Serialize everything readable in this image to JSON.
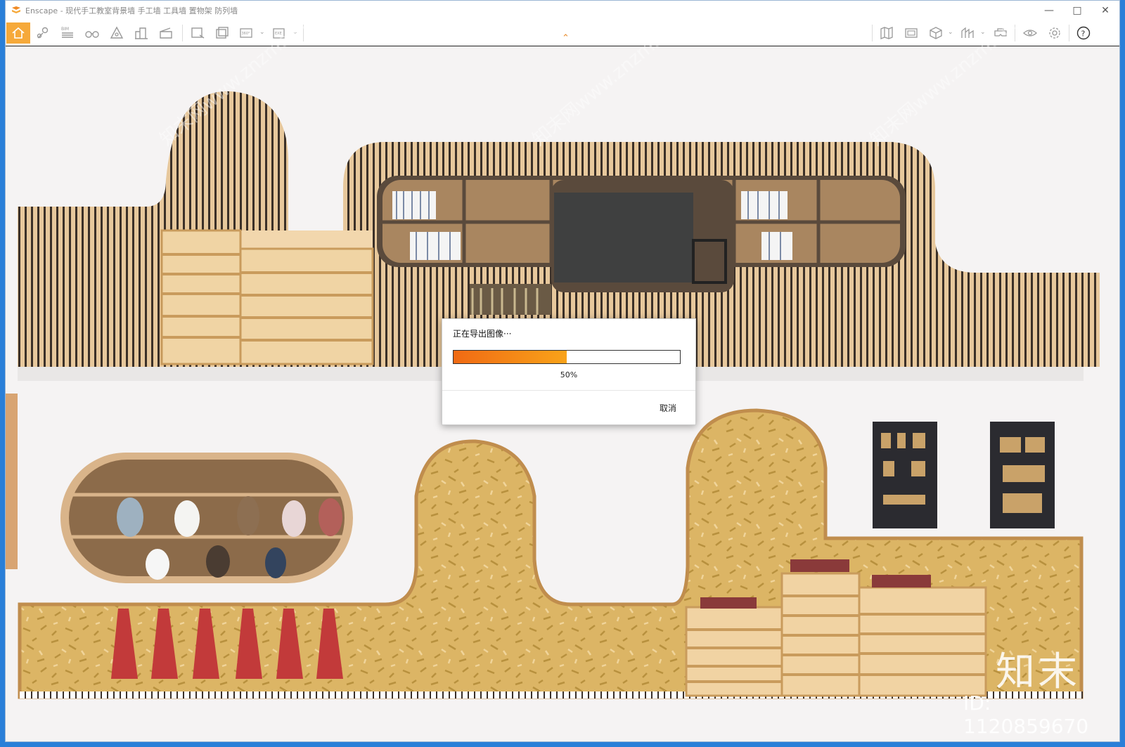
{
  "window": {
    "app_name": "Enscape",
    "title": "Enscape - 现代手工教室背景墙 手工墙 工具墙 置物架 防列墙"
  },
  "toolbar": {
    "bim_label": "BIM",
    "pano_label": "360°",
    "exe_label": "EXE"
  },
  "dialog": {
    "title": "正在导出图像···",
    "progress_percent": 50,
    "progress_label": "50%",
    "cancel_label": "取消"
  },
  "watermark": {
    "brand": "知末",
    "id_label": "ID: 1120859670",
    "site_text": "知末网www.znzmo.com"
  },
  "colors": {
    "accent": "#f6a93a",
    "progress_start": "#f06a14",
    "progress_end": "#f9a319",
    "wood": "#e3c194",
    "cork": "#d8b463"
  }
}
